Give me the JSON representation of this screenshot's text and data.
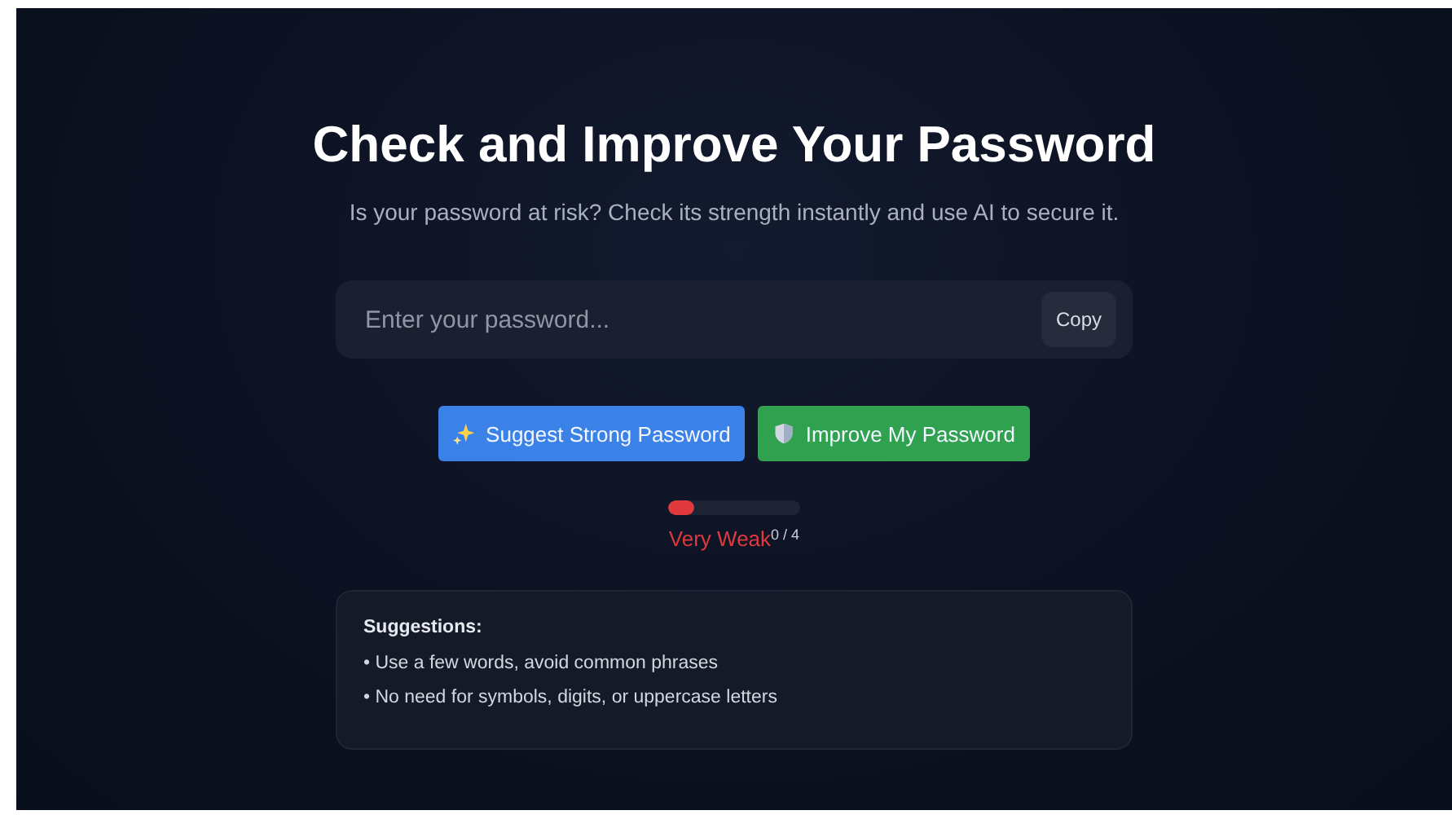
{
  "title": "Check and Improve Your Password",
  "subtitle": "Is your password at risk? Check its strength instantly and use AI to secure it.",
  "password_field": {
    "placeholder": "Enter your password...",
    "copy_button": "Copy"
  },
  "actions": [
    {
      "label": "Suggest Strong Password",
      "kind": "suggest"
    },
    {
      "label": "Improve My Password",
      "kind": "improve"
    }
  ],
  "strength": {
    "level": 0.2,
    "label": "Very Weak",
    "score": "0 / 4",
    "color": "#e0393e"
  },
  "suggestions": {
    "heading": "Suggestions:",
    "items": [
      "• Use a few words, avoid common phrases",
      "• No need for symbols, digits, or uppercase letters"
    ]
  }
}
